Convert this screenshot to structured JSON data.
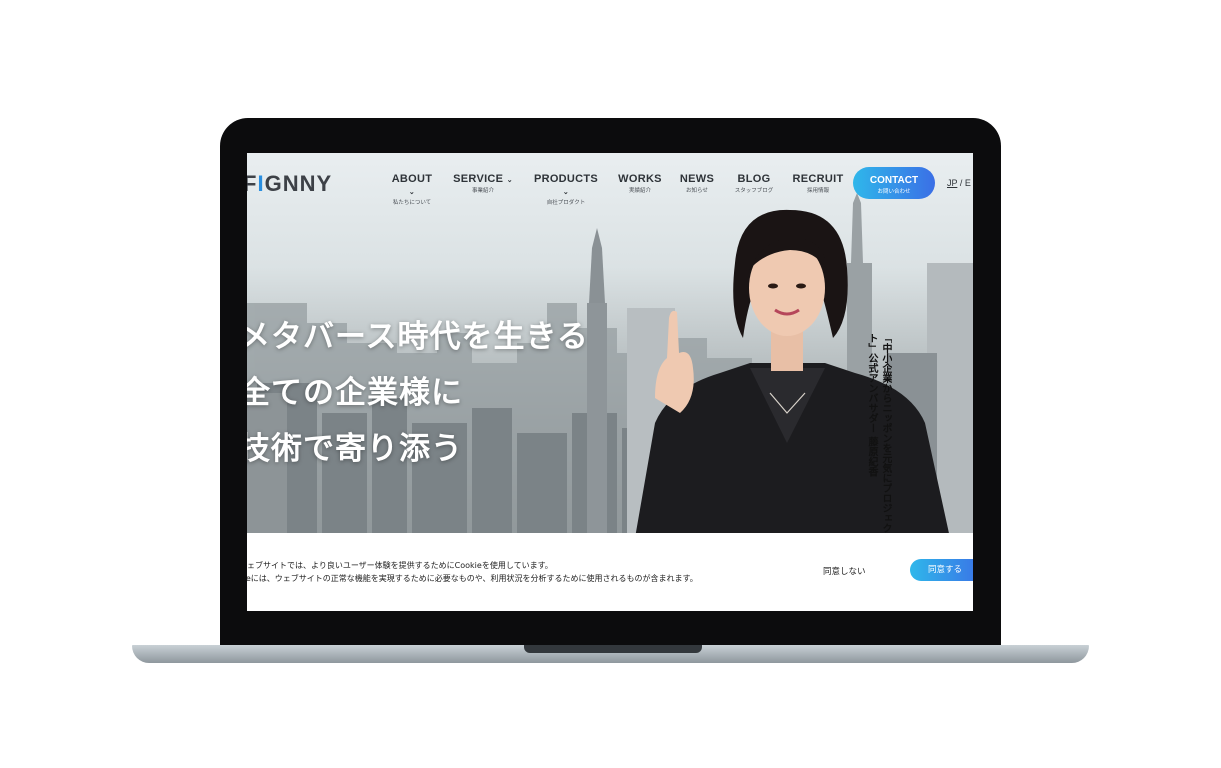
{
  "logo": {
    "text": "FIGNNY",
    "lead": "F",
    "drop": "I",
    "rest": "GNNY"
  },
  "nav": [
    {
      "label": "ABOUT",
      "sub": "私たちについて",
      "dropdown": true
    },
    {
      "label": "SERVICE",
      "sub": "事業紹介",
      "dropdown": true
    },
    {
      "label": "PRODUCTS",
      "sub": "自社プロダクト",
      "dropdown": true
    },
    {
      "label": "WORKS",
      "sub": "実績紹介",
      "dropdown": false
    },
    {
      "label": "NEWS",
      "sub": "お知らせ",
      "dropdown": false
    },
    {
      "label": "BLOG",
      "sub": "スタッフブログ",
      "dropdown": false
    },
    {
      "label": "RECRUIT",
      "sub": "採用情報",
      "dropdown": false
    }
  ],
  "contact": {
    "label": "CONTACT",
    "sub": "お問い合わせ"
  },
  "lang": {
    "jp": "JP",
    "sep": "/",
    "en": "E"
  },
  "hero": {
    "lines": [
      "メタバース時代を生きる",
      "全ての企業様に",
      "技術で寄り添う"
    ],
    "caption": "「中小企業からニッポンを元気にプロジェクト」公式アンバサダー 藤原紀香"
  },
  "cookie": {
    "line1": "ウェブサイトでは、より良いユーザー体験を提供するためにCookieを使用しています。",
    "line2": "kieには、ウェブサイトの正常な機能を実現するために必要なものや、利用状況を分析するために使用されるものが含まれます。",
    "decline": "同意しない",
    "accept": "同意する"
  },
  "colors": {
    "accent_start": "#2fb7ea",
    "accent_end": "#3b6fe6",
    "text_dark": "#2e3338"
  }
}
